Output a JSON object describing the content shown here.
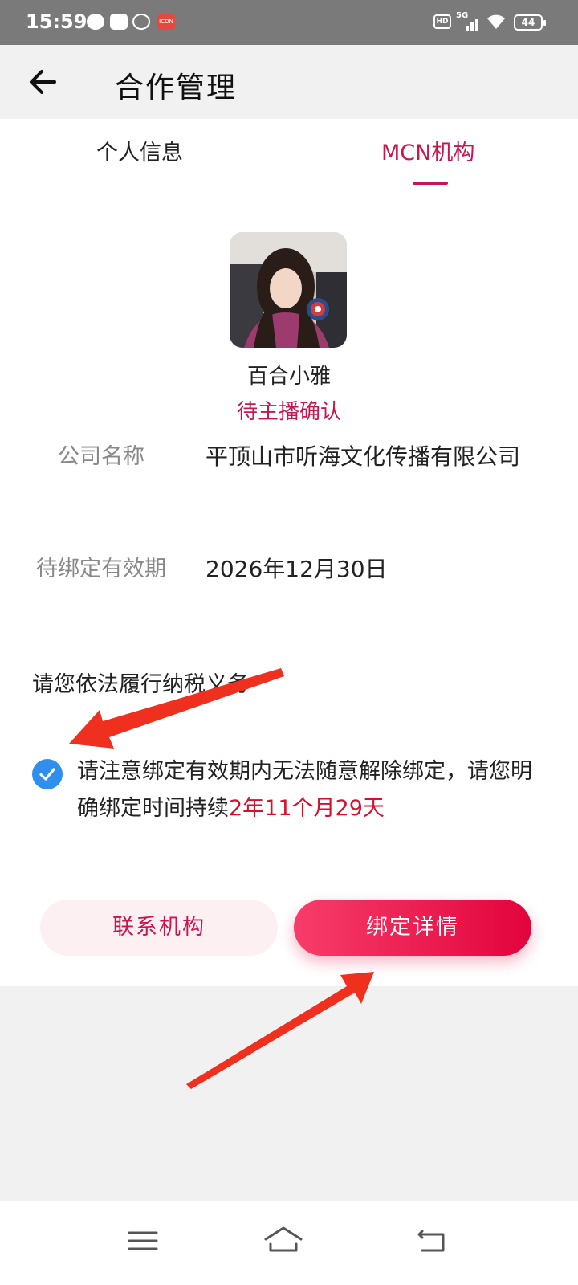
{
  "status_bar": {
    "time": "15:59",
    "app_badge": "ICON",
    "network": "5G",
    "hd": "HD",
    "battery": "44"
  },
  "header": {
    "title": "合作管理"
  },
  "tabs": [
    {
      "label": "个人信息",
      "active": false
    },
    {
      "label": "MCN机构",
      "active": true
    }
  ],
  "profile": {
    "name": "百合小雅",
    "status": "待主播确认"
  },
  "info": {
    "company_label": "公司名称",
    "company_value": "平顶山市听海文化传播有限公司",
    "expiry_label": "待绑定有效期",
    "expiry_value": "2026年12月30日"
  },
  "notice": {
    "tax": "请您依法履行纳税义务",
    "agree_text": "请注意绑定有效期内无法随意解除绑定，请您明确绑定时间持续",
    "agree_highlight": "2年11个月29天",
    "agree_checked": true
  },
  "buttons": {
    "contact": "联系机构",
    "detail": "绑定详情"
  },
  "colors": {
    "accent": "#c8174f",
    "highlight_red": "#d6102c",
    "check_blue": "#2f8fee",
    "annotation_arrow": "#f0301e"
  }
}
